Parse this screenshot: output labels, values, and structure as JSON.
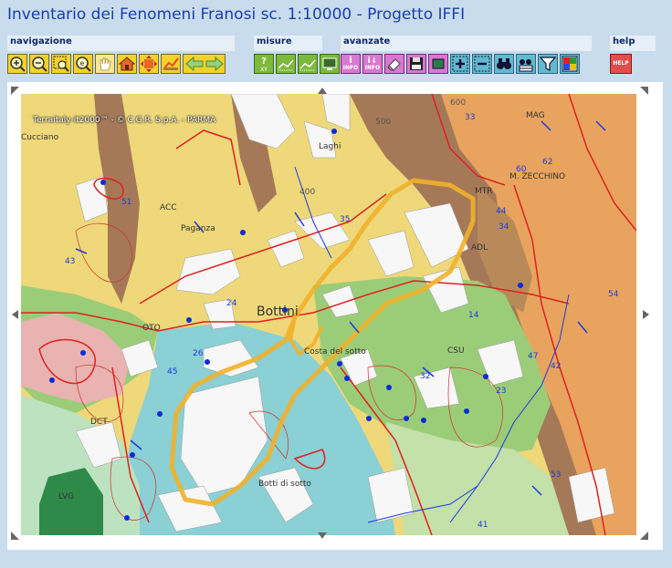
{
  "app": {
    "title": "Inventario dei Fenomeni Franosi sc. 1:10000 - Progetto IFFI"
  },
  "groups": {
    "navigazione": "navigazione",
    "misure": "misure",
    "avanzate": "avanzate",
    "help": "help"
  },
  "tools": {
    "info1": "INFO",
    "info2": "INFO",
    "help": "HELP",
    "xy": "XY"
  },
  "map": {
    "copyright": "Terraitaly-it2000™ - © C.G.R. S.p.A. - PARMA",
    "labels": [
      "ACC",
      "MTR",
      "ADL",
      "CSU",
      "OTO",
      "DCT",
      "LVG",
      "MAG",
      "M. ZECCHINO",
      "Bottini",
      "Costa del sotto",
      "Botti di sotto",
      "Laghi",
      "Paganza",
      "Cucciano"
    ],
    "numbers": [
      "33",
      "60",
      "62",
      "44",
      "34",
      "43",
      "35",
      "54",
      "45",
      "26",
      "32",
      "24",
      "42",
      "14",
      "51",
      "23",
      "47",
      "53",
      "41",
      "500",
      "400",
      "600"
    ],
    "colors": {
      "yellow": "#f0dc78",
      "brown": "#a47a5a",
      "orange": "#e6a55a",
      "green": "#98ce7a",
      "cyan": "#88d2d6",
      "pink": "#e6b0b0",
      "landslide_outline": "#e02020",
      "highlight": "#f0b020",
      "points": "#0a2bd8"
    }
  }
}
